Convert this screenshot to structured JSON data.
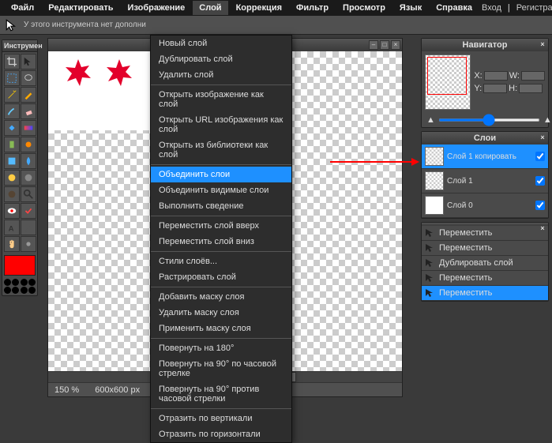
{
  "menubar": {
    "items": [
      "Файл",
      "Редактировать",
      "Изображение",
      "Слой",
      "Коррекция",
      "Фильтр",
      "Просмотр",
      "Язык",
      "Справка"
    ],
    "active_index": 3,
    "login": "Вход",
    "register": "Регистрация"
  },
  "toolbar_info": "У этого инструмента нет дополни",
  "tools_panel_title": "Инструмен",
  "navigator": {
    "title": "Навигатор",
    "x_label": "X:",
    "y_label": "Y:",
    "w_label": "W:",
    "h_label": "H:",
    "zoom": "150",
    "zoom_unit": "%"
  },
  "layers": {
    "title": "Слои",
    "items": [
      {
        "name": "Слой 1 копировать",
        "selected": true,
        "visible": true
      },
      {
        "name": "Слой 1",
        "selected": false,
        "visible": true
      },
      {
        "name": "Слой 0",
        "selected": false,
        "visible": true
      }
    ]
  },
  "history": {
    "items": [
      {
        "label": "Переместить",
        "selected": false
      },
      {
        "label": "Переместить",
        "selected": false
      },
      {
        "label": "Дублировать слой",
        "selected": false
      },
      {
        "label": "Переместить",
        "selected": false
      },
      {
        "label": "Переместить",
        "selected": true
      }
    ]
  },
  "dropdown": {
    "groups": [
      [
        "Новый слой",
        "Дублировать слой",
        "Удалить слой"
      ],
      [
        "Открыть изображение как слой",
        "Открыть URL изображения как слой",
        "Открыть из библиотеки как слой"
      ],
      [
        "Объединить слои",
        "Объединить видимые слои",
        "Выполнить сведение"
      ],
      [
        "Переместить слой вверх",
        "Переместить слой вниз"
      ],
      [
        "Стили слоёв...",
        "Растрировать слой"
      ],
      [
        "Добавить маску слоя",
        "Удалить маску слоя",
        "Применить маску слоя"
      ],
      [
        "Повернуть на 180°",
        "Повернуть на 90° по часовой стрелке",
        "Повернуть на 90° против часовой стрелки"
      ],
      [
        "Отразить по вертикали",
        "Отразить по горизонтали"
      ]
    ],
    "highlighted": "Объединить слои"
  },
  "status": {
    "zoom": "150 %",
    "dims": "600x600 px"
  }
}
